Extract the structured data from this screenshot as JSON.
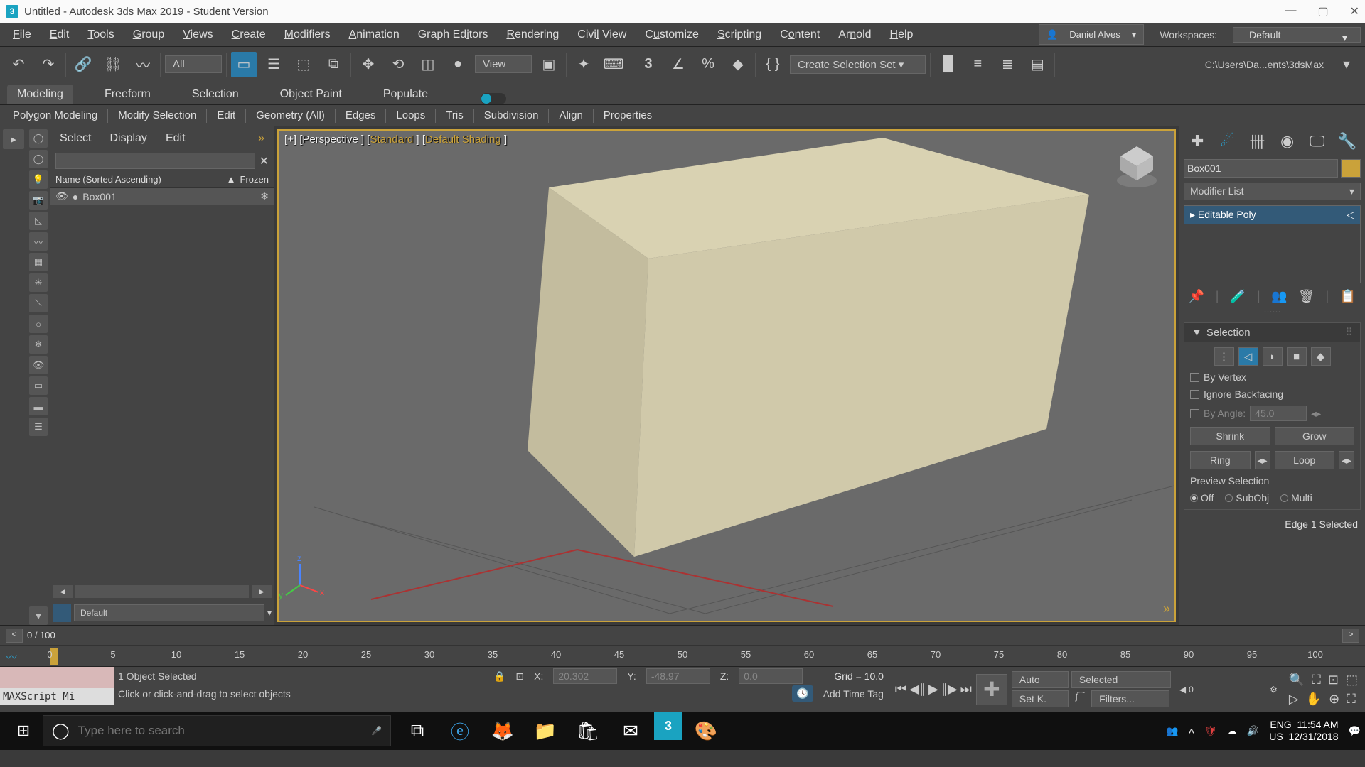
{
  "titlebar": {
    "title": "Untitled - Autodesk 3ds Max 2019 - Student Version"
  },
  "menu": {
    "items": [
      "File",
      "Edit",
      "Tools",
      "Group",
      "Views",
      "Create",
      "Modifiers",
      "Animation",
      "Graph Editors",
      "Rendering",
      "Civil View",
      "Customize",
      "Scripting",
      "Content",
      "Arnold",
      "Help"
    ],
    "user": "Daniel Alves",
    "ws_label": "Workspaces:",
    "ws_value": "Default"
  },
  "toolbar": {
    "filter": "All",
    "view": "View",
    "selset": "Create Selection Set",
    "path": "C:\\Users\\Da...ents\\3dsMax"
  },
  "ribbon": {
    "tabs": [
      "Modeling",
      "Freeform",
      "Selection",
      "Object Paint",
      "Populate"
    ],
    "panels": [
      "Polygon Modeling",
      "Modify Selection",
      "Edit",
      "Geometry (All)",
      "Edges",
      "Loops",
      "Tris",
      "Subdivision",
      "Align",
      "Properties"
    ]
  },
  "scene": {
    "menu": [
      "Select",
      "Display",
      "Edit"
    ],
    "col1": "Name (Sorted Ascending)",
    "col2": "▲",
    "col3": "Frozen",
    "item": "Box001",
    "layer": "Default",
    "scroll_left": "◄",
    "scroll_right": "►"
  },
  "viewport": {
    "label": "[+] [Perspective ]  [",
    "std": "Standard",
    "mid": " ]  [",
    "shd": "Default Shading",
    "end": " ]",
    "axis_x": "x",
    "axis_y": "y",
    "axis_z": "z"
  },
  "cmd": {
    "name": "Box001",
    "modlist": "Modifier List",
    "mod": "Editable Poly",
    "sel_title": "Selection",
    "byvertex": "By Vertex",
    "ignorebf": "Ignore Backfacing",
    "byangle": "By Angle:",
    "angle": "45.0",
    "shrink": "Shrink",
    "grow": "Grow",
    "ring": "Ring",
    "loop": "Loop",
    "preview": "Preview Selection",
    "off": "Off",
    "subobj": "SubObj",
    "multi": "Multi",
    "status": "Edge 1 Selected"
  },
  "time": {
    "pos": "0 / 100",
    "ticks": [
      0,
      5,
      10,
      15,
      20,
      25,
      30,
      35,
      40,
      45,
      50,
      55,
      60,
      65,
      70,
      75,
      80,
      85,
      90,
      95,
      100
    ]
  },
  "status": {
    "sel": "1 Object Selected",
    "prompt": "Click or click-and-drag to select objects",
    "mxs": "MAXScript Mi",
    "x_label": "X:",
    "x": "20.302",
    "y_label": "Y:",
    "y": "-48.97",
    "z_label": "Z:",
    "z": "0.0",
    "grid": "Grid = 10.0",
    "addtag": "Add Time Tag",
    "auto": "Auto",
    "setk": "Set K.",
    "selected": "Selected",
    "filters": "Filters...",
    "zero": "0"
  },
  "taskbar": {
    "search": "Type here to search",
    "lang1": "ENG",
    "lang2": "US",
    "time": "11:54 AM",
    "date": "12/31/2018",
    "notif": "3"
  }
}
